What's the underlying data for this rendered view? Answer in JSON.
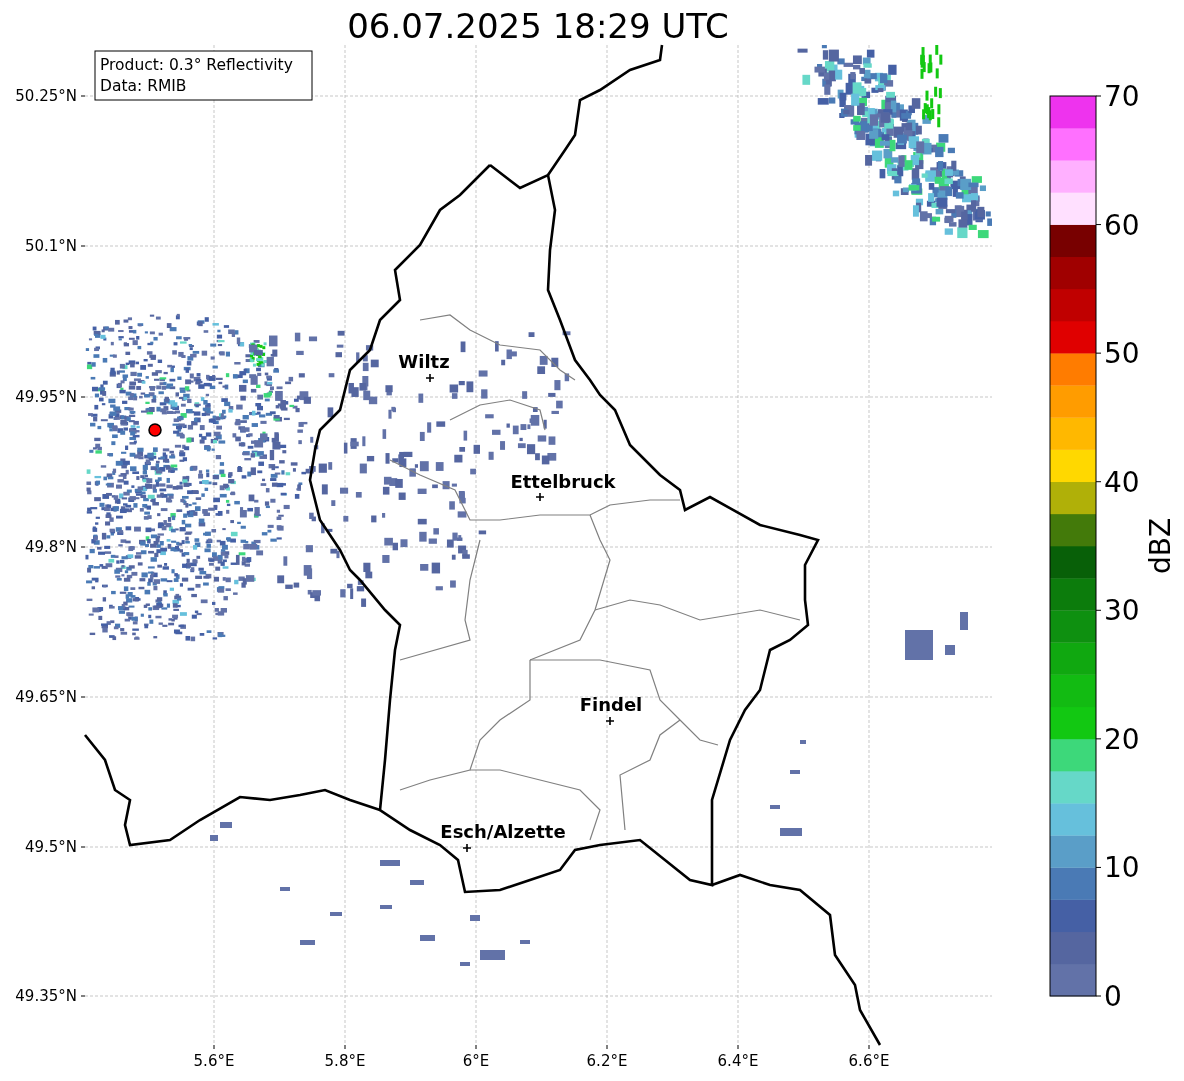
{
  "title": "06.07.2025 18:29 UTC",
  "info_box": [
    "Product: 0.3° Reflectivity",
    "Data: RMIB"
  ],
  "map": {
    "lat_ticks": [
      "50.25°N",
      "50.1°N",
      "49.95°N",
      "49.8°N",
      "49.65°N",
      "49.5°N",
      "49.35°N"
    ],
    "lon_ticks": [
      "5.6°E",
      "5.8°E",
      "6°E",
      "6.2°E",
      "6.4°E",
      "6.6°E"
    ],
    "cities": [
      {
        "name": "Wiltz"
      },
      {
        "name": "Ettelbruck"
      },
      {
        "name": "Findel"
      },
      {
        "name": "Esch/Alzette"
      }
    ]
  },
  "colorbar": {
    "label": "dBZ",
    "ticks": [
      "70",
      "60",
      "50",
      "40",
      "30",
      "20",
      "10",
      "0"
    ],
    "steps": [
      {
        "color": "#6272a8"
      },
      {
        "color": "#5566a0"
      },
      {
        "color": "#4560a5"
      },
      {
        "color": "#4a7ab5"
      },
      {
        "color": "#5a9ec8"
      },
      {
        "color": "#66c0dc"
      },
      {
        "color": "#66d8c8"
      },
      {
        "color": "#3dd87a"
      },
      {
        "color": "#12c812"
      },
      {
        "color": "#12bb12"
      },
      {
        "color": "#10a810"
      },
      {
        "color": "#0e9010"
      },
      {
        "color": "#0c7c0c"
      },
      {
        "color": "#086008"
      },
      {
        "color": "#437a0a"
      },
      {
        "color": "#b0b008"
      },
      {
        "color": "#ffd800"
      },
      {
        "color": "#ffb800"
      },
      {
        "color": "#ff9c00"
      },
      {
        "color": "#ff7c00"
      },
      {
        "color": "#e00000"
      },
      {
        "color": "#c00000"
      },
      {
        "color": "#a00000"
      },
      {
        "color": "#780000"
      },
      {
        "color": "#ffe0ff"
      },
      {
        "color": "#ffb0ff"
      },
      {
        "color": "#ff70ff"
      },
      {
        "color": "#ee33ee"
      }
    ]
  }
}
